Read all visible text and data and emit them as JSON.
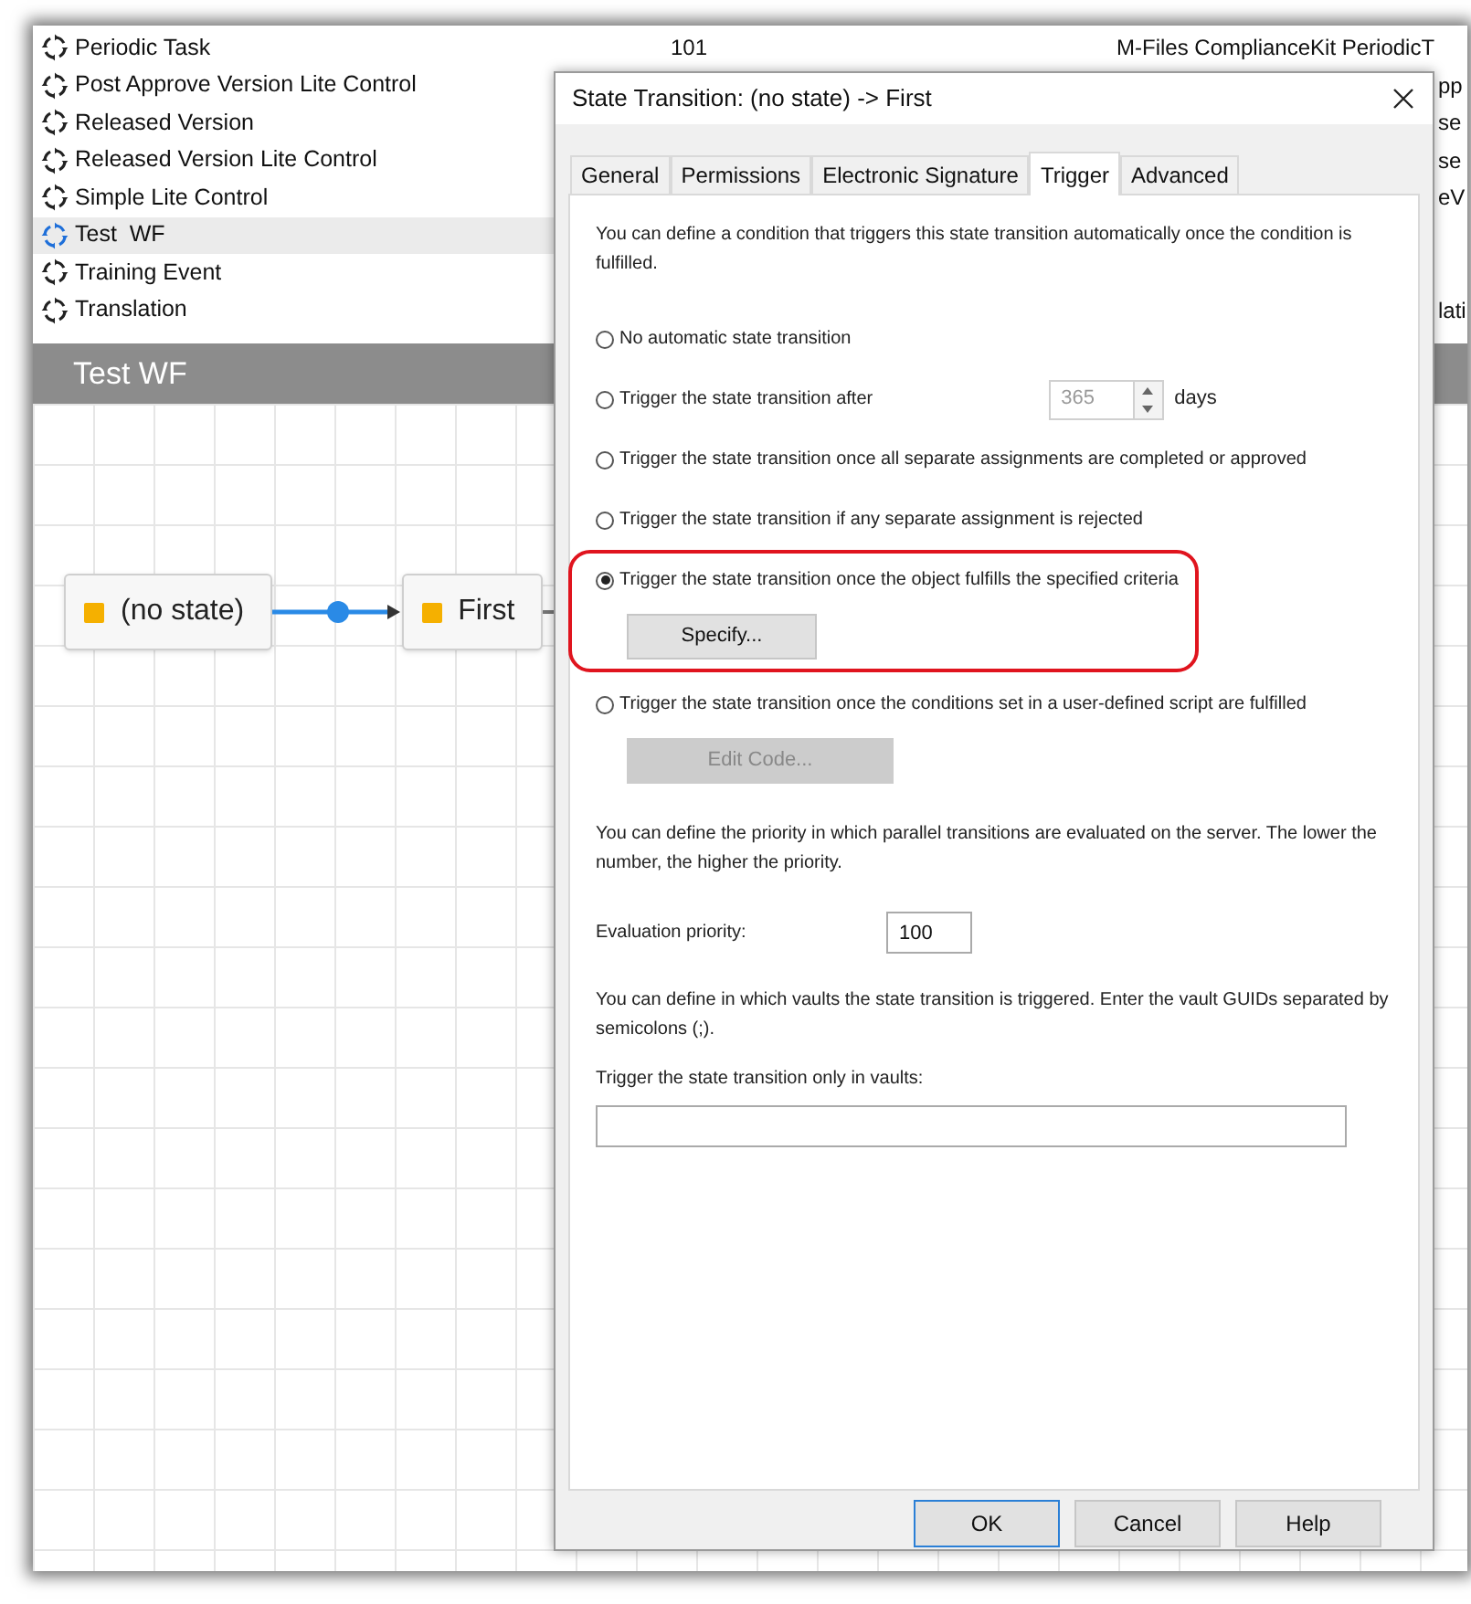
{
  "list": {
    "rows": [
      {
        "name": "Periodic Task",
        "column_2": "101",
        "column_3": "M-Files ComplianceKit PeriodicT",
        "selected": false
      },
      {
        "name": "Post Approve Version Lite Control",
        "column_3": "pp",
        "selected": false
      },
      {
        "name": "Released Version",
        "column_3": "se",
        "selected": false
      },
      {
        "name": "Released Version Lite Control",
        "column_3": "se",
        "selected": false
      },
      {
        "name": "Simple Lite Control",
        "column_3": "eV",
        "selected": false
      },
      {
        "name": "Test  WF",
        "selected": true
      },
      {
        "name": "Training Event",
        "selected": false
      },
      {
        "name": "Translation",
        "column_3": "lati",
        "selected": false
      }
    ]
  },
  "header": {
    "title": "Test WF"
  },
  "diagram": {
    "states": [
      {
        "label": "(no state)"
      },
      {
        "label": "First"
      }
    ]
  },
  "dialog": {
    "title": "State Transition: (no state) -> First",
    "tabs": [
      {
        "label": "General",
        "selected": false
      },
      {
        "label": "Permissions",
        "selected": false
      },
      {
        "label": "Electronic Signature",
        "selected": false
      },
      {
        "label": "Trigger",
        "selected": true
      },
      {
        "label": "Advanced",
        "selected": false
      }
    ],
    "intro": "You can define a condition that triggers this state transition automatically once the condition is fulfilled.",
    "options": [
      {
        "label": "No automatic state transition",
        "selected": false,
        "highlighted": false
      },
      {
        "label": "Trigger the state transition after",
        "selected": false,
        "highlighted": false,
        "spinner": {
          "value": "365",
          "unit": "days",
          "disabled": true
        }
      },
      {
        "label": "Trigger the state transition once all separate assignments are completed or approved",
        "selected": false,
        "highlighted": false
      },
      {
        "label": "Trigger the state transition if any separate assignment is rejected",
        "selected": false,
        "highlighted": false
      },
      {
        "label": "Trigger the state transition once the object fulfills the specified criteria",
        "selected": true,
        "highlighted": true,
        "button": {
          "label": "Specify...",
          "disabled": false
        }
      },
      {
        "label": "Trigger the state transition once the conditions set in a user-defined script are fulfilled",
        "selected": false,
        "highlighted": false,
        "button": {
          "label": "Edit Code...",
          "disabled": true
        }
      }
    ],
    "priority_note": "You can define the priority in which parallel transitions are evaluated on the server. The lower the number, the higher the priority.",
    "priority": {
      "label": "Evaluation priority:",
      "value": "100"
    },
    "vaults_note": "You can define in which vaults the state transition is triggered. Enter the vault GUIDs separated by semicolons (;).",
    "vaults": {
      "label": "Trigger the state transition only in vaults:"
    },
    "buttons": [
      {
        "label": "OK",
        "default": true
      },
      {
        "label": "Cancel",
        "default": false
      },
      {
        "label": "Help",
        "default": false
      }
    ]
  }
}
